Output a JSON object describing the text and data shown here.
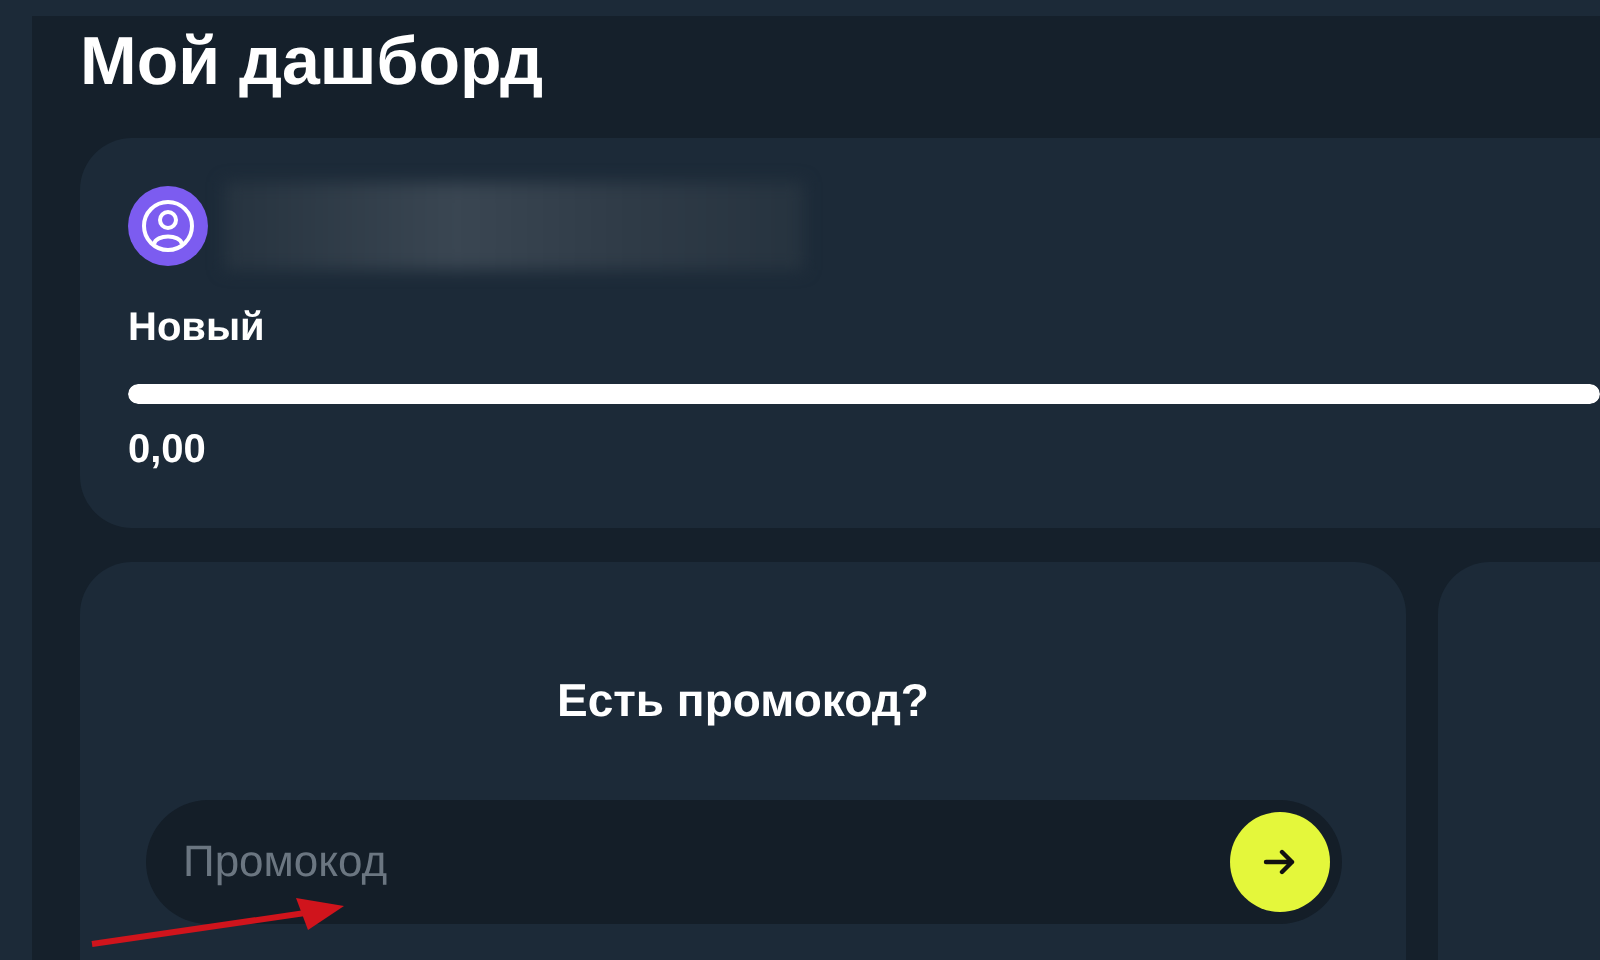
{
  "page_title": "Мой дашборд",
  "profile": {
    "status": "Новый",
    "progress": {
      "level": 1
    },
    "balance": "0,00"
  },
  "promo": {
    "title": "Есть промокод?",
    "placeholder": "Промокод"
  }
}
